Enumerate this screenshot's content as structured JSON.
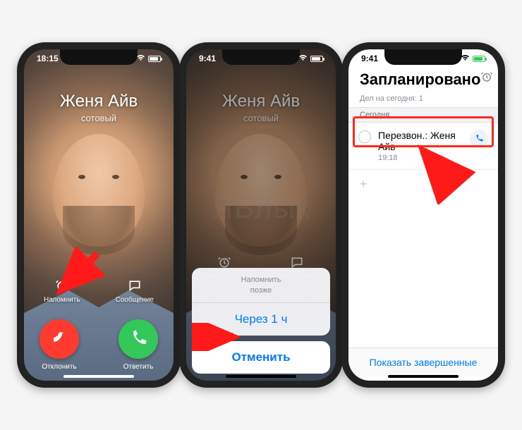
{
  "phone1": {
    "status": {
      "time": "18:15"
    },
    "caller": {
      "name": "Женя Айв",
      "type": "сотовый"
    },
    "quick": {
      "remind": "Напомнить",
      "message": "Сообщение"
    },
    "actions": {
      "decline": "Отклонить",
      "accept": "Ответить"
    }
  },
  "phone2": {
    "status": {
      "time": "9:41"
    },
    "caller": {
      "name": "Женя Айв",
      "type": "сотовый"
    },
    "quick": {
      "remind": "Напомнить",
      "message": "Сообщение"
    },
    "sheet": {
      "header_line1": "Напомнить",
      "header_line2": "позже",
      "option_1h": "Через 1 ч",
      "cancel": "Отменить"
    }
  },
  "phone3": {
    "status": {
      "time": "9:41"
    },
    "header": {
      "title": "Запланировано",
      "subcount": "Дел на сегодня: 1"
    },
    "section": "Сегодня",
    "reminder": {
      "title": "Перезвон.: Женя Айв",
      "time": "19:18"
    },
    "footer": "Показать завершенные"
  },
  "watermark": "ЯБлык"
}
